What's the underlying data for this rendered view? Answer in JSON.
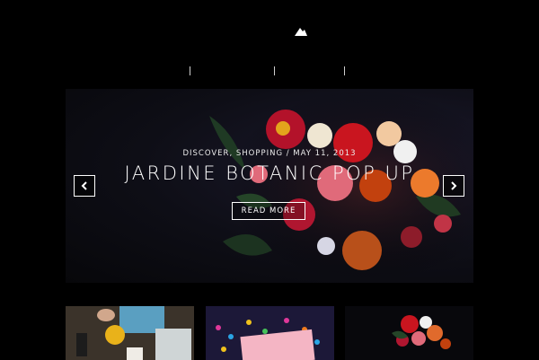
{
  "header": {
    "logo_icon": "mountain-logo-icon"
  },
  "slider": {
    "meta": "DISCOVER, SHOPPING / MAY 11, 2013",
    "title": "JARDINE BOTANIC POP UP",
    "read_more": "READ MORE",
    "prev_icon": "chevron-left-icon",
    "next_icon": "chevron-right-icon"
  },
  "thumbnails": [
    {
      "name": "coffee-pour"
    },
    {
      "name": "confetti-card"
    },
    {
      "name": "flower-bouquet"
    }
  ],
  "colors": {
    "background": "#000000",
    "text": "#ffffff"
  }
}
